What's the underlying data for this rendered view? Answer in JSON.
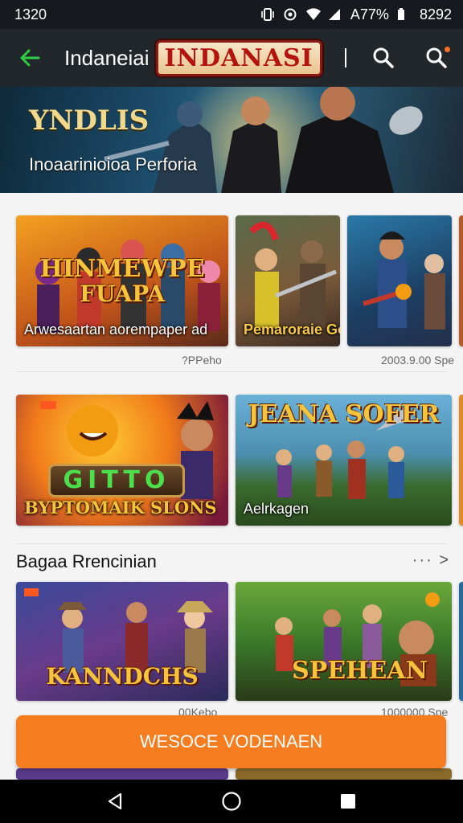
{
  "status_bar": {
    "time": "1320",
    "battery": "A77%",
    "clock_right": "8292"
  },
  "app_bar": {
    "title": "Indaneiai",
    "logo_text": "INDANASI"
  },
  "banner": {
    "heading": "YNDLIS",
    "subtitle": "Inoaarinioioa Perforia"
  },
  "row1": {
    "cards": [
      {
        "caption": "Arwesaartan aorempaper ad",
        "title_line1": "HINMEWPE",
        "title_line2": "FUAPA",
        "meta": "?PPeho"
      },
      {
        "caption": "Pemaroraie Gon",
        "meta": ""
      },
      {
        "caption": "",
        "meta": "2003.9.00 Spe"
      }
    ]
  },
  "row2": {
    "cards": [
      {
        "caption": "BYPTOMAIK SLONS",
        "logo": "GITTO"
      },
      {
        "caption": "Aelrkagen",
        "title": "JEANA SOFER"
      }
    ]
  },
  "section": {
    "title": "Bagaa Rrencinian",
    "more": "··· >"
  },
  "row3": {
    "cards": [
      {
        "title": "KANNDCHS",
        "meta": "00Kebo"
      },
      {
        "title": "SPEHEAN",
        "meta": "1000000 Spe"
      }
    ]
  },
  "cta": {
    "label": "WESOCE VODENAEN"
  },
  "colors": {
    "accent": "#f57c1f",
    "app_bar": "#22272c",
    "back_arrow": "#2ecc40"
  }
}
